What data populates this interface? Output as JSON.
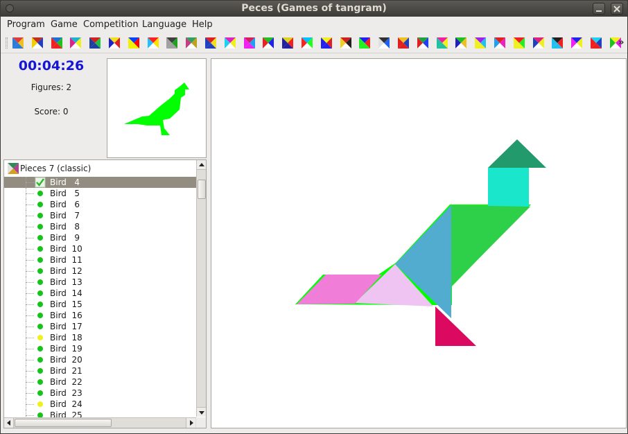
{
  "window": {
    "title": "Peces (Games of tangram)"
  },
  "menubar": {
    "items": [
      "Program",
      "Game",
      "Competition",
      "Language",
      "Help"
    ]
  },
  "toolbar": {
    "more_label": "»"
  },
  "status": {
    "timer": "00:04:26",
    "figures": "Figures: 2",
    "score": "Score: 0"
  },
  "tree": {
    "root_label": "Pieces 7 (classic)",
    "items": [
      {
        "label": "Bird   4",
        "status": "solved"
      },
      {
        "label": "Bird   5",
        "status": "green"
      },
      {
        "label": "Bird   6",
        "status": "green"
      },
      {
        "label": "Bird   7",
        "status": "green"
      },
      {
        "label": "Bird   8",
        "status": "green"
      },
      {
        "label": "Bird   9",
        "status": "green"
      },
      {
        "label": "Bird  10",
        "status": "green"
      },
      {
        "label": "Bird  11",
        "status": "green"
      },
      {
        "label": "Bird  12",
        "status": "green"
      },
      {
        "label": "Bird  13",
        "status": "green"
      },
      {
        "label": "Bird  14",
        "status": "green"
      },
      {
        "label": "Bird  15",
        "status": "green"
      },
      {
        "label": "Bird  16",
        "status": "green"
      },
      {
        "label": "Bird  17",
        "status": "green"
      },
      {
        "label": "Bird  18",
        "status": "yellow"
      },
      {
        "label": "Bird  19",
        "status": "green"
      },
      {
        "label": "Bird  20",
        "status": "green"
      },
      {
        "label": "Bird  21",
        "status": "green"
      },
      {
        "label": "Bird  22",
        "status": "green"
      },
      {
        "label": "Bird  23",
        "status": "green"
      },
      {
        "label": "Bird  24",
        "status": "yellow"
      },
      {
        "label": "Bird  25",
        "status": "green"
      }
    ]
  },
  "colors": {
    "timer": "#1515d8",
    "silhouette": "#00ff00",
    "status_green": "#18c21c",
    "status_yellow": "#f0f01e",
    "selected_row": "#928d80"
  }
}
